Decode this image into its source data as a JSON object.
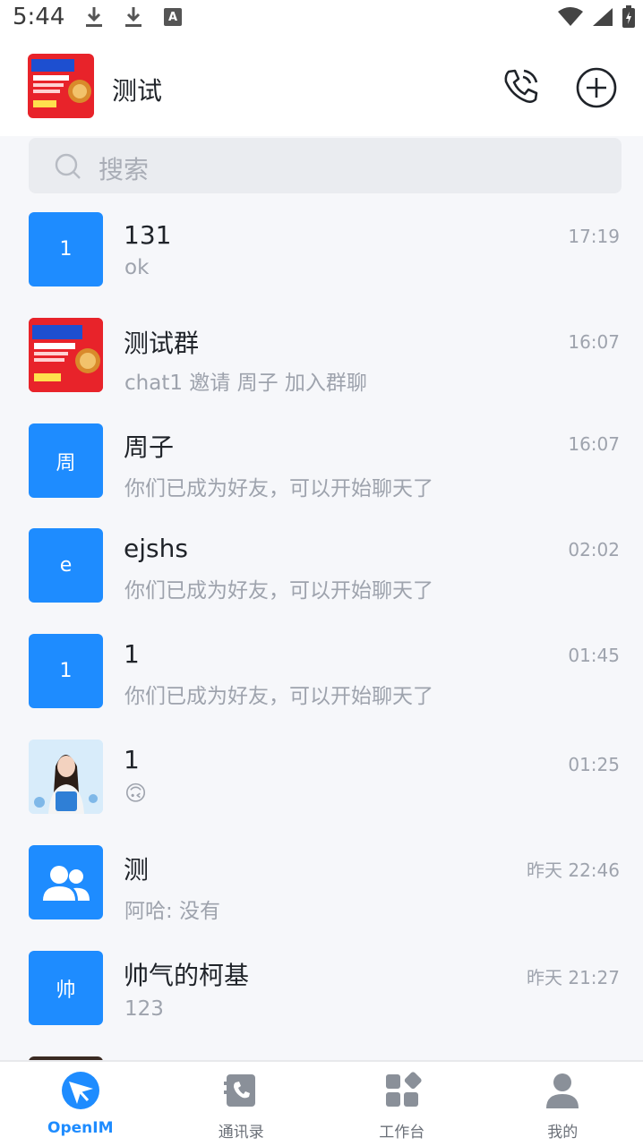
{
  "status_bar": {
    "time": "5:44",
    "badge": "A"
  },
  "header": {
    "title": "测试"
  },
  "search": {
    "placeholder": "搜索"
  },
  "conversations": [
    {
      "avatar_text": "1",
      "name": "131",
      "message": "ok",
      "time": "17:19"
    },
    {
      "avatar_text": "",
      "name": "测试群",
      "message": "chat1 邀请 周子 加入群聊",
      "time": "16:07"
    },
    {
      "avatar_text": "周",
      "name": "周子",
      "message": "你们已成为好友，可以开始聊天了",
      "time": "16:07"
    },
    {
      "avatar_text": "e",
      "name": "ejshs",
      "message": "你们已成为好友，可以开始聊天了",
      "time": "02:02"
    },
    {
      "avatar_text": "1",
      "name": "1",
      "message": "你们已成为好友，可以开始聊天了",
      "time": "01:45"
    },
    {
      "avatar_text": "",
      "name": "1",
      "message": "🙃",
      "time": "01:25"
    },
    {
      "avatar_text": "",
      "name": "测",
      "message": "阿哈: 没有",
      "time": "昨天 22:46"
    },
    {
      "avatar_text": "帅",
      "name": "帅气的柯基",
      "message": "123",
      "time": "昨天 21:27"
    }
  ],
  "bottom_nav": [
    {
      "label": "OpenIM",
      "icon": "openim-logo-icon",
      "active": true
    },
    {
      "label": "通讯录",
      "icon": "contacts-icon",
      "active": false
    },
    {
      "label": "工作台",
      "icon": "workbench-icon",
      "active": false
    },
    {
      "label": "我的",
      "icon": "profile-icon",
      "active": false
    }
  ],
  "colors": {
    "accent": "#1e8cff",
    "list_bg": "#f6f7fa",
    "muted_text": "#9ea3ad"
  }
}
